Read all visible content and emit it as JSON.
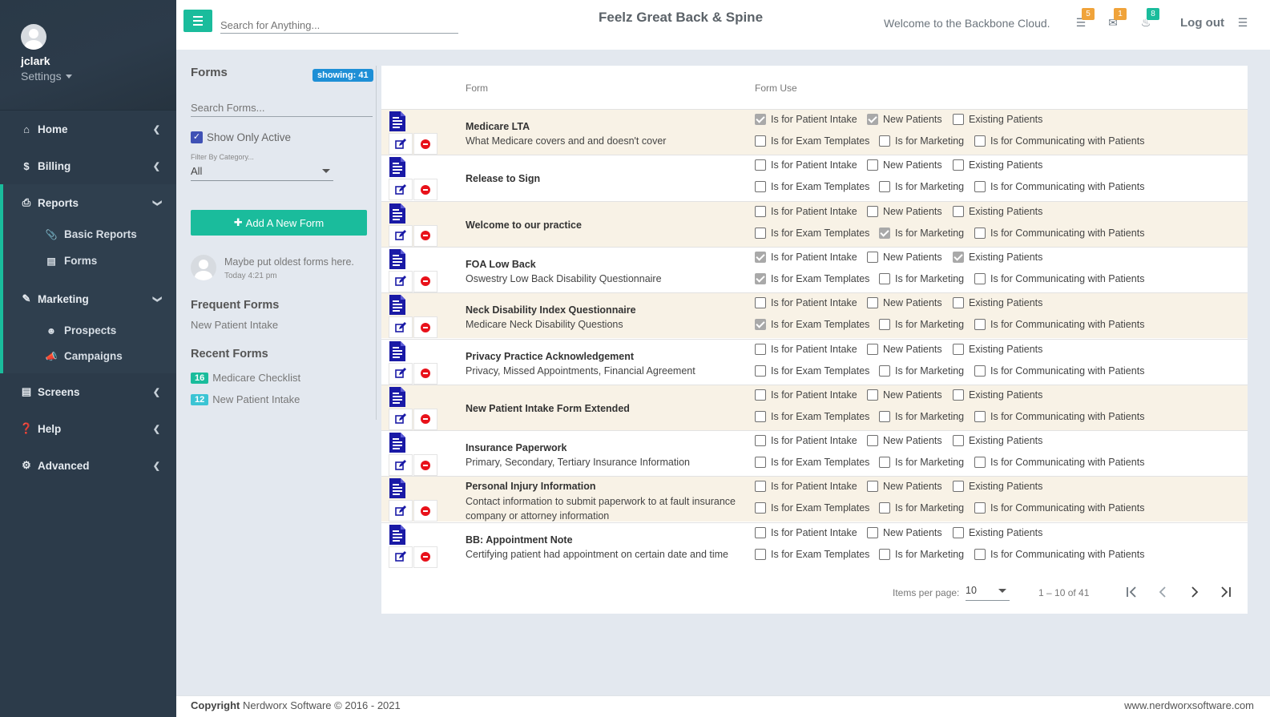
{
  "user": {
    "name": "jclark",
    "settings_label": "Settings"
  },
  "sidebar": {
    "items": [
      {
        "label": "Home",
        "icon": "home-icon"
      },
      {
        "label": "Billing",
        "icon": "dollar-icon"
      },
      {
        "label": "Reports",
        "icon": "printer-icon",
        "sub": [
          {
            "label": "Basic Reports",
            "icon": "paperclip-icon"
          },
          {
            "label": "Forms",
            "icon": "document-icon"
          }
        ]
      },
      {
        "label": "Marketing",
        "icon": "scroll-icon",
        "sub": [
          {
            "label": "Prospects",
            "icon": "user-plus-icon"
          },
          {
            "label": "Campaigns",
            "icon": "megaphone-icon"
          }
        ]
      },
      {
        "label": "Screens",
        "icon": "screens-icon"
      },
      {
        "label": "Help",
        "icon": "question-icon"
      },
      {
        "label": "Advanced",
        "icon": "cogs-icon"
      }
    ]
  },
  "topbar": {
    "search_placeholder": "Search for Anything...",
    "brand": "Feelz Great Back & Spine",
    "welcome": "Welcome to the Backbone Cloud.",
    "tasks_count": "5",
    "messages_count": "1",
    "notifications_count": "8",
    "logout_label": "Log out"
  },
  "forms_panel": {
    "title": "Forms",
    "showing": "showing: 41",
    "search_placeholder": "Search Forms...",
    "show_only_active": "Show Only Active",
    "filter_label": "Filter By Category...",
    "filter_value": "All",
    "add_button": "Add A New Form",
    "note_text": "Maybe put oldest forms here.",
    "note_time": "Today 4:21 pm",
    "frequent_title": "Frequent Forms",
    "frequent_items": [
      "New Patient Intake"
    ],
    "recent_title": "Recent Forms",
    "recent_items": [
      {
        "count": "16",
        "label": "Medicare Checklist",
        "color": "#1abc9c"
      },
      {
        "count": "12",
        "label": "New Patient Intake",
        "color": "#3bc4d4"
      }
    ]
  },
  "table": {
    "headers": {
      "form": "Form",
      "form_use": "Form Use"
    },
    "use_labels": {
      "intake": "Is for Patient Intake",
      "new": "New Patients",
      "existing": "Existing Patients",
      "exam": "Is for Exam Templates",
      "marketing": "Is for Marketing",
      "comm": "Is for Communicating with Patients"
    },
    "rows": [
      {
        "name": "Medicare LTA",
        "desc": "What Medicare covers and and doesn't cover",
        "intake": true,
        "new": true,
        "existing": false,
        "exam": false,
        "marketing": false,
        "comm": false
      },
      {
        "name": "Release to Sign",
        "desc": "",
        "intake": false,
        "new": false,
        "existing": false,
        "exam": false,
        "marketing": false,
        "comm": false
      },
      {
        "name": "Welcome to our practice",
        "desc": "",
        "intake": false,
        "new": false,
        "existing": false,
        "exam": false,
        "marketing": true,
        "comm": false
      },
      {
        "name": "FOA Low Back",
        "desc": "Oswestry Low Back Disability Questionnaire",
        "intake": true,
        "new": false,
        "existing": true,
        "exam": true,
        "marketing": false,
        "comm": false
      },
      {
        "name": "Neck Disability Index Questionnaire",
        "desc": "Medicare Neck Disability Questions",
        "intake": false,
        "new": false,
        "existing": false,
        "exam": true,
        "marketing": false,
        "comm": false
      },
      {
        "name": "Privacy Practice Acknowledgement",
        "desc": "Privacy, Missed Appointments, Financial Agreement",
        "intake": false,
        "new": false,
        "existing": false,
        "exam": false,
        "marketing": false,
        "comm": false
      },
      {
        "name": "New Patient Intake Form Extended",
        "desc": "",
        "intake": false,
        "new": false,
        "existing": false,
        "exam": false,
        "marketing": false,
        "comm": false
      },
      {
        "name": "Insurance Paperwork",
        "desc": "Primary, Secondary, Tertiary Insurance Information",
        "intake": false,
        "new": false,
        "existing": false,
        "exam": false,
        "marketing": false,
        "comm": false
      },
      {
        "name": "Personal Injury Information",
        "desc": "Contact information to submit paperwork to at fault insurance company or attorney information",
        "intake": false,
        "new": false,
        "existing": false,
        "exam": false,
        "marketing": false,
        "comm": false
      },
      {
        "name": "BB: Appointment Note",
        "desc": "Certifying patient had appointment on certain date and time",
        "intake": false,
        "new": false,
        "existing": false,
        "exam": false,
        "marketing": false,
        "comm": false
      }
    ]
  },
  "paginator": {
    "label": "Items per page:",
    "page_size": "10",
    "range": "1 – 10 of 41"
  },
  "footer": {
    "copyright_bold": "Copyright",
    "copyright_rest": " Nerdworx Software © 2016 - 2021",
    "site": "www.nerdworxsoftware.com"
  },
  "colors": {
    "accent": "#1abc9c",
    "sidebar": "#2c3b4a",
    "row_alt": "#f8f2e6",
    "doc_icon": "#1a1aa6",
    "delete": "#e8111a"
  }
}
